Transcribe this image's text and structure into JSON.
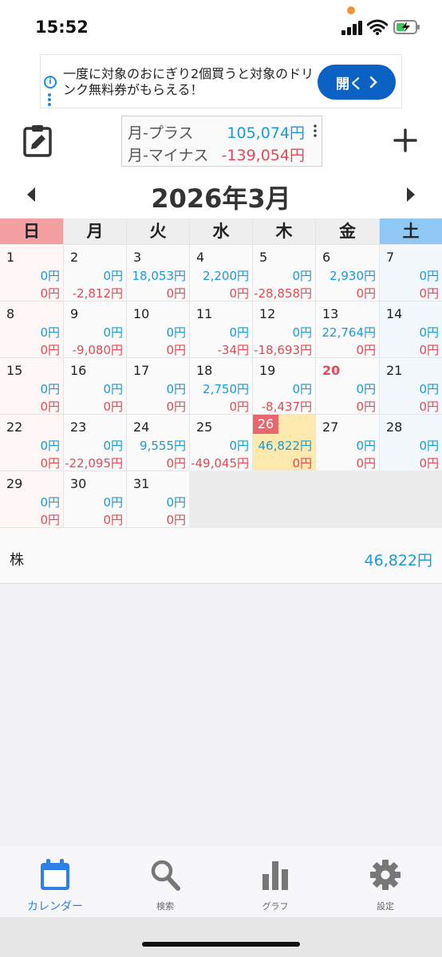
{
  "status_bar": {
    "time": "15:52"
  },
  "ad": {
    "text": "一度に対象のおにぎり2個買うと対象のドリンク無料券がもらえる！",
    "button_label": "開く"
  },
  "summary": {
    "plus_label": "月-プラス",
    "plus_value": "105,074円",
    "minus_label": "月-マイナス",
    "minus_value": "-139,054円"
  },
  "month_title": "2026年3月",
  "weekdays": [
    "日",
    "月",
    "火",
    "水",
    "木",
    "金",
    "土"
  ],
  "colors": {
    "sunday_header": "#f4a0a3",
    "saturday_header": "#8fc8f5",
    "plus": "#1a9bd4",
    "minus": "#e24b55",
    "today_badge": "#e8666e",
    "today_bg": "#fde9ad",
    "tab_active": "#2e80e6"
  },
  "calendar": {
    "start_weekday": 0,
    "today": 26,
    "holidays": [
      20
    ],
    "days": [
      {
        "day": "1",
        "plus": "0円",
        "minus": "0円"
      },
      {
        "day": "2",
        "plus": "0円",
        "minus": "-2,812円"
      },
      {
        "day": "3",
        "plus": "18,053円",
        "minus": "0円"
      },
      {
        "day": "4",
        "plus": "2,200円",
        "minus": "0円"
      },
      {
        "day": "5",
        "plus": "0円",
        "minus": "-28,858円"
      },
      {
        "day": "6",
        "plus": "2,930円",
        "minus": "0円"
      },
      {
        "day": "7",
        "plus": "0円",
        "minus": "0円"
      },
      {
        "day": "8",
        "plus": "0円",
        "minus": "0円"
      },
      {
        "day": "9",
        "plus": "0円",
        "minus": "-9,080円"
      },
      {
        "day": "10",
        "plus": "0円",
        "minus": "0円"
      },
      {
        "day": "11",
        "plus": "0円",
        "minus": "-34円"
      },
      {
        "day": "12",
        "plus": "0円",
        "minus": "-18,693円"
      },
      {
        "day": "13",
        "plus": "22,764円",
        "minus": "0円"
      },
      {
        "day": "14",
        "plus": "0円",
        "minus": "0円"
      },
      {
        "day": "15",
        "plus": "0円",
        "minus": "0円"
      },
      {
        "day": "16",
        "plus": "0円",
        "minus": "0円"
      },
      {
        "day": "17",
        "plus": "0円",
        "minus": "0円"
      },
      {
        "day": "18",
        "plus": "2,750円",
        "minus": "0円"
      },
      {
        "day": "19",
        "plus": "0円",
        "minus": "-8,437円"
      },
      {
        "day": "20",
        "plus": "0円",
        "minus": "0円"
      },
      {
        "day": "21",
        "plus": "0円",
        "minus": "0円"
      },
      {
        "day": "22",
        "plus": "0円",
        "minus": "0円"
      },
      {
        "day": "23",
        "plus": "0円",
        "minus": "-22,095円"
      },
      {
        "day": "24",
        "plus": "9,555円",
        "minus": "0円"
      },
      {
        "day": "25",
        "plus": "0円",
        "minus": "-49,045円"
      },
      {
        "day": "26",
        "plus": "46,822円",
        "minus": "0円"
      },
      {
        "day": "27",
        "plus": "0円",
        "minus": "0円"
      },
      {
        "day": "28",
        "plus": "0円",
        "minus": "0円"
      },
      {
        "day": "29",
        "plus": "0円",
        "minus": "0円"
      },
      {
        "day": "30",
        "plus": "0円",
        "minus": "0円"
      },
      {
        "day": "31",
        "plus": "0円",
        "minus": "0円"
      }
    ]
  },
  "detail": {
    "label": "株",
    "value": "46,822円"
  },
  "tabs": [
    {
      "label": "カレンダー",
      "icon": "calendar-icon",
      "active": true
    },
    {
      "label": "検索",
      "icon": "search-icon",
      "active": false
    },
    {
      "label": "グラフ",
      "icon": "bar-chart-icon",
      "active": false
    },
    {
      "label": "設定",
      "icon": "gear-icon",
      "active": false
    }
  ]
}
